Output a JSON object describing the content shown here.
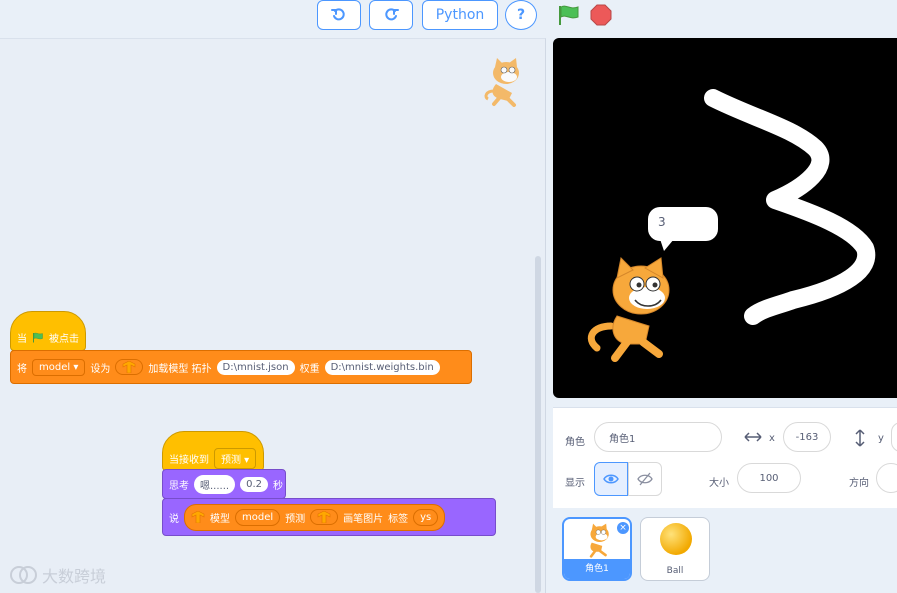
{
  "toolbar": {
    "python_label": "Python",
    "help_label": "?"
  },
  "code": {
    "block1": {
      "hat_when": "当",
      "hat_clicked": "被点击",
      "set_prefix": "将",
      "var_name": "model",
      "set_to": "设为",
      "load_model": "加载模型 拓扑",
      "topology_file": "D:\\mnist.json",
      "weights_label": "权重",
      "weights_file": "D:\\mnist.weights.bin"
    },
    "block2": {
      "hat_receive": "当接收到",
      "message": "预测",
      "think_label": "思考",
      "think_text": "嗯......",
      "think_secs": "0.2",
      "secs_label": "秒",
      "say_label": "说",
      "model_label": "模型",
      "model_var": "model",
      "predict_label": "预测",
      "pen_image": "画笔图片",
      "tag_label": "标签",
      "tag_value": "ys"
    },
    "watermark": "大数跨境"
  },
  "stage": {
    "speech": "3"
  },
  "sprite_info": {
    "sprite_label": "角色",
    "sprite_name": "角色1",
    "x_label": "x",
    "x_value": "-163",
    "y_label": "y",
    "show_label": "显示",
    "size_label": "大小",
    "size_value": "100",
    "direction_label": "方向"
  },
  "sprites": [
    {
      "name": "角色1",
      "selected": true
    },
    {
      "name": "Ball",
      "selected": false
    }
  ],
  "colors": {
    "accent": "#4c97ff",
    "events": "#ffbf00",
    "variables": "#ff8c1a",
    "looks": "#9966ff",
    "flag": "#4cbf56",
    "stop": "#ec5959"
  }
}
